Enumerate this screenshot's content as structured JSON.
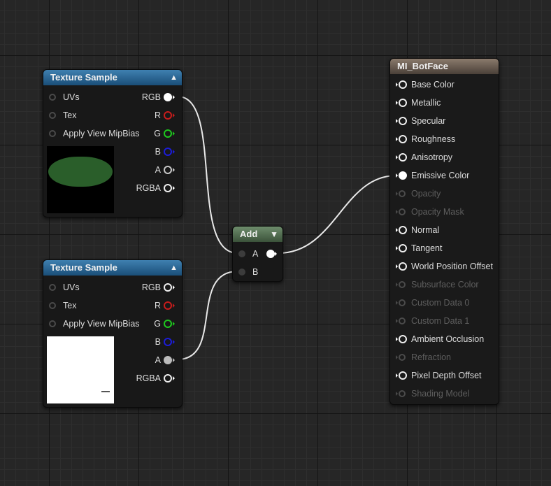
{
  "texture_node_1": {
    "title": "Texture Sample",
    "inputs": [
      "UVs",
      "Tex",
      "Apply View MipBias"
    ],
    "outputs": [
      "RGB",
      "R",
      "G",
      "B",
      "A",
      "RGBA"
    ]
  },
  "texture_node_2": {
    "title": "Texture Sample",
    "inputs": [
      "UVs",
      "Tex",
      "Apply View MipBias"
    ],
    "outputs": [
      "RGB",
      "R",
      "G",
      "B",
      "A",
      "RGBA"
    ]
  },
  "add_node": {
    "title": "Add",
    "inputs": [
      "A",
      "B"
    ]
  },
  "material_node": {
    "title": "MI_BotFace",
    "inputs": [
      {
        "label": "Base Color",
        "enabled": true
      },
      {
        "label": "Metallic",
        "enabled": true
      },
      {
        "label": "Specular",
        "enabled": true
      },
      {
        "label": "Roughness",
        "enabled": true
      },
      {
        "label": "Anisotropy",
        "enabled": true
      },
      {
        "label": "Emissive Color",
        "enabled": true
      },
      {
        "label": "Opacity",
        "enabled": false
      },
      {
        "label": "Opacity Mask",
        "enabled": false
      },
      {
        "label": "Normal",
        "enabled": true
      },
      {
        "label": "Tangent",
        "enabled": true
      },
      {
        "label": "World Position Offset",
        "enabled": true
      },
      {
        "label": "Subsurface Color",
        "enabled": false
      },
      {
        "label": "Custom Data 0",
        "enabled": false
      },
      {
        "label": "Custom Data 1",
        "enabled": false
      },
      {
        "label": "Ambient Occlusion",
        "enabled": true
      },
      {
        "label": "Refraction",
        "enabled": false
      },
      {
        "label": "Pixel Depth Offset",
        "enabled": true
      },
      {
        "label": "Shading Model",
        "enabled": false
      }
    ]
  },
  "colors": {
    "r_pin": "#c81c1c",
    "g_pin": "#1ec81e",
    "b_pin": "#1c1cd8",
    "wire": "#e8e8e8"
  },
  "icons": {
    "collapse": "chevron-up-icon",
    "add_menu": "chevron-down-icon"
  }
}
